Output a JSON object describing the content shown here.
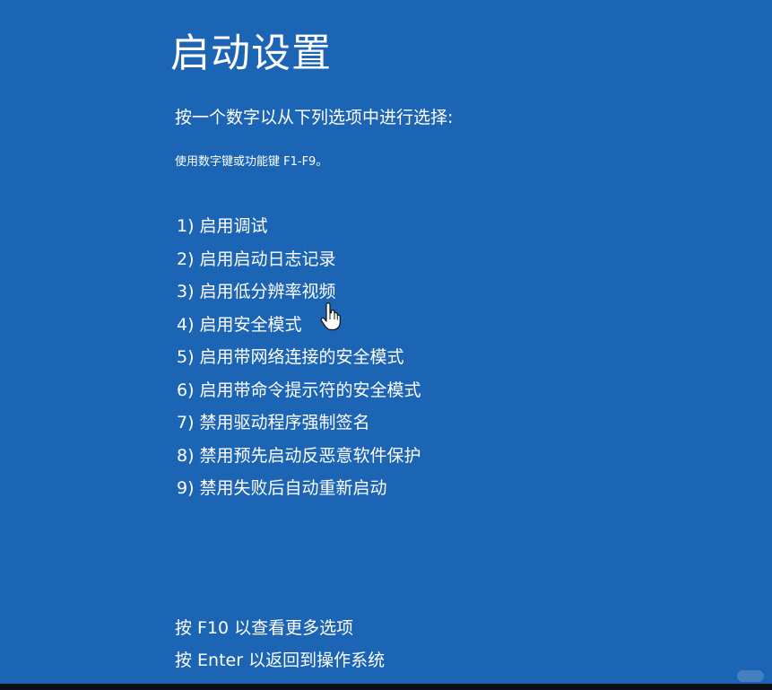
{
  "screen": {
    "title": "启动设置",
    "subtitle": "按一个数字以从下列选项中进行选择:",
    "hint": "使用数字键或功能键 F1-F9。",
    "options": [
      "1) 启用调试",
      "2) 启用启动日志记录",
      "3) 启用低分辨率视频",
      "4) 启用安全模式",
      "5) 启用带网络连接的安全模式",
      "6) 启用带命令提示符的安全模式",
      "7) 禁用驱动程序强制签名",
      "8) 禁用预先启动反恶意软件保护",
      "9) 禁用失败后自动重新启动"
    ],
    "footer": {
      "more_options": "按 F10 以查看更多选项",
      "return_os": "按 Enter 以返回到操作系统"
    }
  },
  "colors": {
    "background": "#1c64b4",
    "text": "#ffffff"
  },
  "icons": {
    "cursor": "hand-pointer-icon"
  }
}
